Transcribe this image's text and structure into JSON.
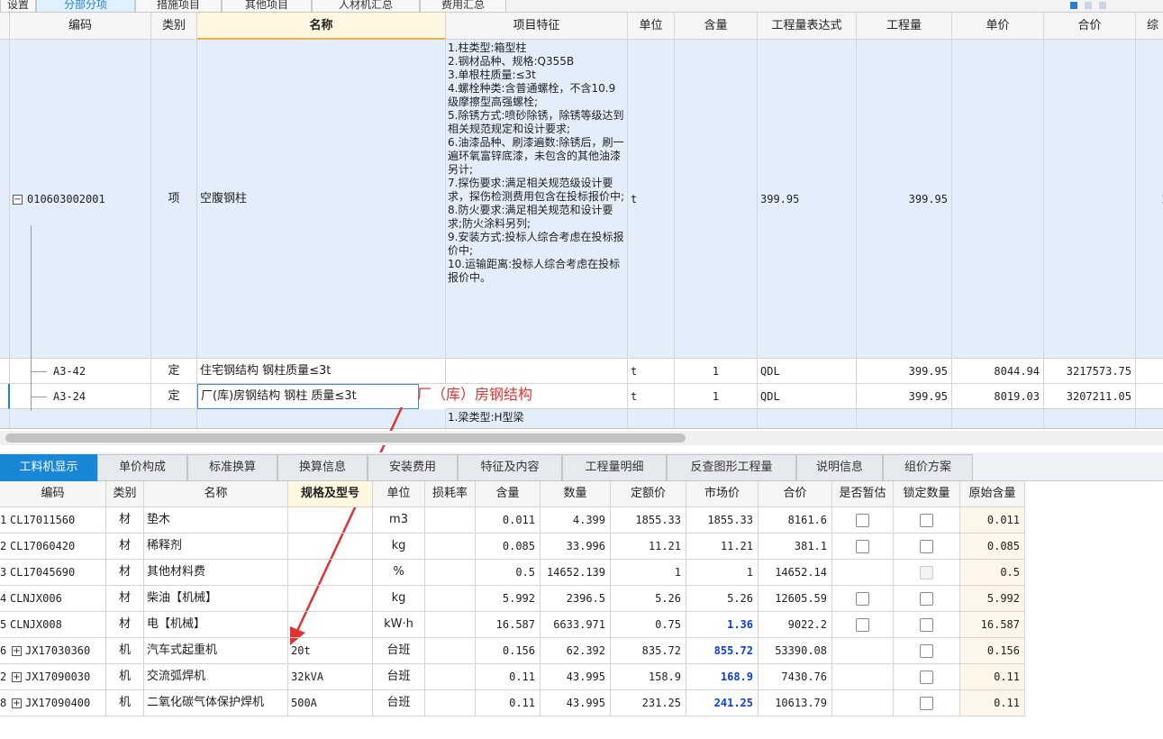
{
  "top_tabs": [
    "设置",
    "分部分项",
    "措施项目",
    "其他项目",
    "人材机汇总",
    "费用汇总"
  ],
  "upper_grid": {
    "headers": [
      "编码",
      "类别",
      "名称",
      "项目特征",
      "单位",
      "含量",
      "工程量表达式",
      "工程量",
      "单价",
      "合价",
      "综"
    ],
    "main_row": {
      "code": "010603002001",
      "type": "项",
      "name": "空腹钢柱",
      "features": "1.柱类型:箱型柱\n2.钢材品种、规格:Q355B\n3.单根柱质量:≤3t\n4.螺栓种类:含普通螺栓，不含10.9级摩擦型高强螺栓;\n5.除锈方式:喷砂除锈，除锈等级达到相关规范规定和设计要求;\n6.油漆品种、刷漆遍数:除锈后，刷一遍环氧富锌底漆，未包含的其他油漆另计;\n7.探伤要求:满足相关规范级设计要求，探伤检测费用包含在投标报价中;\n8.防火要求:满足相关规范和设计要求;防火涂料另列;\n9.安装方式:投标人综合考虑在投标报价中;\n10.运输距离:投标人综合考虑在投标报价中。",
      "unit": "t",
      "expr": "399.95",
      "qty": "399.95",
      "last_col": "1"
    },
    "sub_rows": [
      {
        "code": "A3-42",
        "type": "定",
        "name": "住宅钢结构 钢柱质量≤3t",
        "unit": "t",
        "content": "1",
        "expr": "QDL",
        "qty": "399.95",
        "price": "8044.94",
        "total": "3217573.75"
      },
      {
        "code": "A3-24",
        "type": "定",
        "name": "厂(库)房钢结构 钢柱 质量≤3t",
        "unit": "t",
        "content": "1",
        "expr": "QDL",
        "qty": "399.95",
        "price": "8019.03",
        "total": "3207211.05"
      }
    ],
    "next_row_features": "1.梁类型:H型梁",
    "annotation": "厂（库）房钢结构"
  },
  "lower_tabs": [
    "工料机显示",
    "单价构成",
    "标准换算",
    "换算信息",
    "安装费用",
    "特征及内容",
    "工程量明细",
    "反查图形工程量",
    "说明信息",
    "组价方案"
  ],
  "lower_grid": {
    "headers": [
      "编码",
      "类别",
      "名称",
      "规格及型号",
      "单位",
      "损耗率",
      "含量",
      "数量",
      "定额价",
      "市场价",
      "合价",
      "是否暂估",
      "锁定数量",
      "原始含量"
    ],
    "rows": [
      {
        "idx": "1",
        "code": "CL17011560",
        "type": "材",
        "name": "垫木",
        "spec": "",
        "unit": "m3",
        "loss": "",
        "content": "0.011",
        "qty": "4.399",
        "std": "1855.33",
        "market": "1855.33",
        "total": "8161.6",
        "orig": "0.011"
      },
      {
        "idx": "2",
        "code": "CL17060420",
        "type": "材",
        "name": "稀释剂",
        "spec": "",
        "unit": "kg",
        "loss": "",
        "content": "0.085",
        "qty": "33.996",
        "std": "11.21",
        "market": "11.21",
        "total": "381.1",
        "orig": "0.085"
      },
      {
        "idx": "3",
        "code": "CL17045690",
        "type": "材",
        "name": "其他材料费",
        "spec": "",
        "unit": "%",
        "loss": "",
        "content": "0.5",
        "qty": "14652.139",
        "std": "1",
        "market": "1",
        "total": "14652.14",
        "orig": "0.5"
      },
      {
        "idx": "4",
        "code": "CLNJX006",
        "type": "材",
        "name": "柴油【机械】",
        "spec": "",
        "unit": "kg",
        "loss": "",
        "content": "5.992",
        "qty": "2396.5",
        "std": "5.26",
        "market": "5.26",
        "total": "12605.59",
        "orig": "5.992"
      },
      {
        "idx": "5",
        "code": "CLNJX008",
        "type": "材",
        "name": "电【机械】",
        "spec": "",
        "unit": "kW·h",
        "loss": "",
        "content": "16.587",
        "qty": "6633.971",
        "std": "0.75",
        "market": "1.36",
        "total": "9022.2",
        "orig": "16.587"
      },
      {
        "idx": "6",
        "code": "JX17030360",
        "type": "机",
        "name": "汽车式起重机",
        "spec": "20t",
        "unit": "台班",
        "loss": "",
        "content": "0.156",
        "qty": "62.392",
        "std": "835.72",
        "market": "855.72",
        "total": "53390.08",
        "orig": "0.156"
      },
      {
        "idx": "2",
        "code": "JX17090030",
        "type": "机",
        "name": "交流弧焊机",
        "spec": "32kVA",
        "unit": "台班",
        "loss": "",
        "content": "0.11",
        "qty": "43.995",
        "std": "158.9",
        "market": "168.9",
        "total": "7430.76",
        "orig": "0.11"
      },
      {
        "idx": "8",
        "code": "JX17090400",
        "type": "机",
        "name": "二氧化碳气体保护焊机",
        "spec": "500A",
        "unit": "台班",
        "loss": "",
        "content": "0.11",
        "qty": "43.995",
        "std": "231.25",
        "market": "241.25",
        "total": "10613.79",
        "orig": "0.11"
      }
    ]
  },
  "colors": {
    "accent": "#1a86d6",
    "annotation": "#e03232",
    "market_highlight": "#0a3ee8",
    "selected_row": "#e4eefb"
  }
}
